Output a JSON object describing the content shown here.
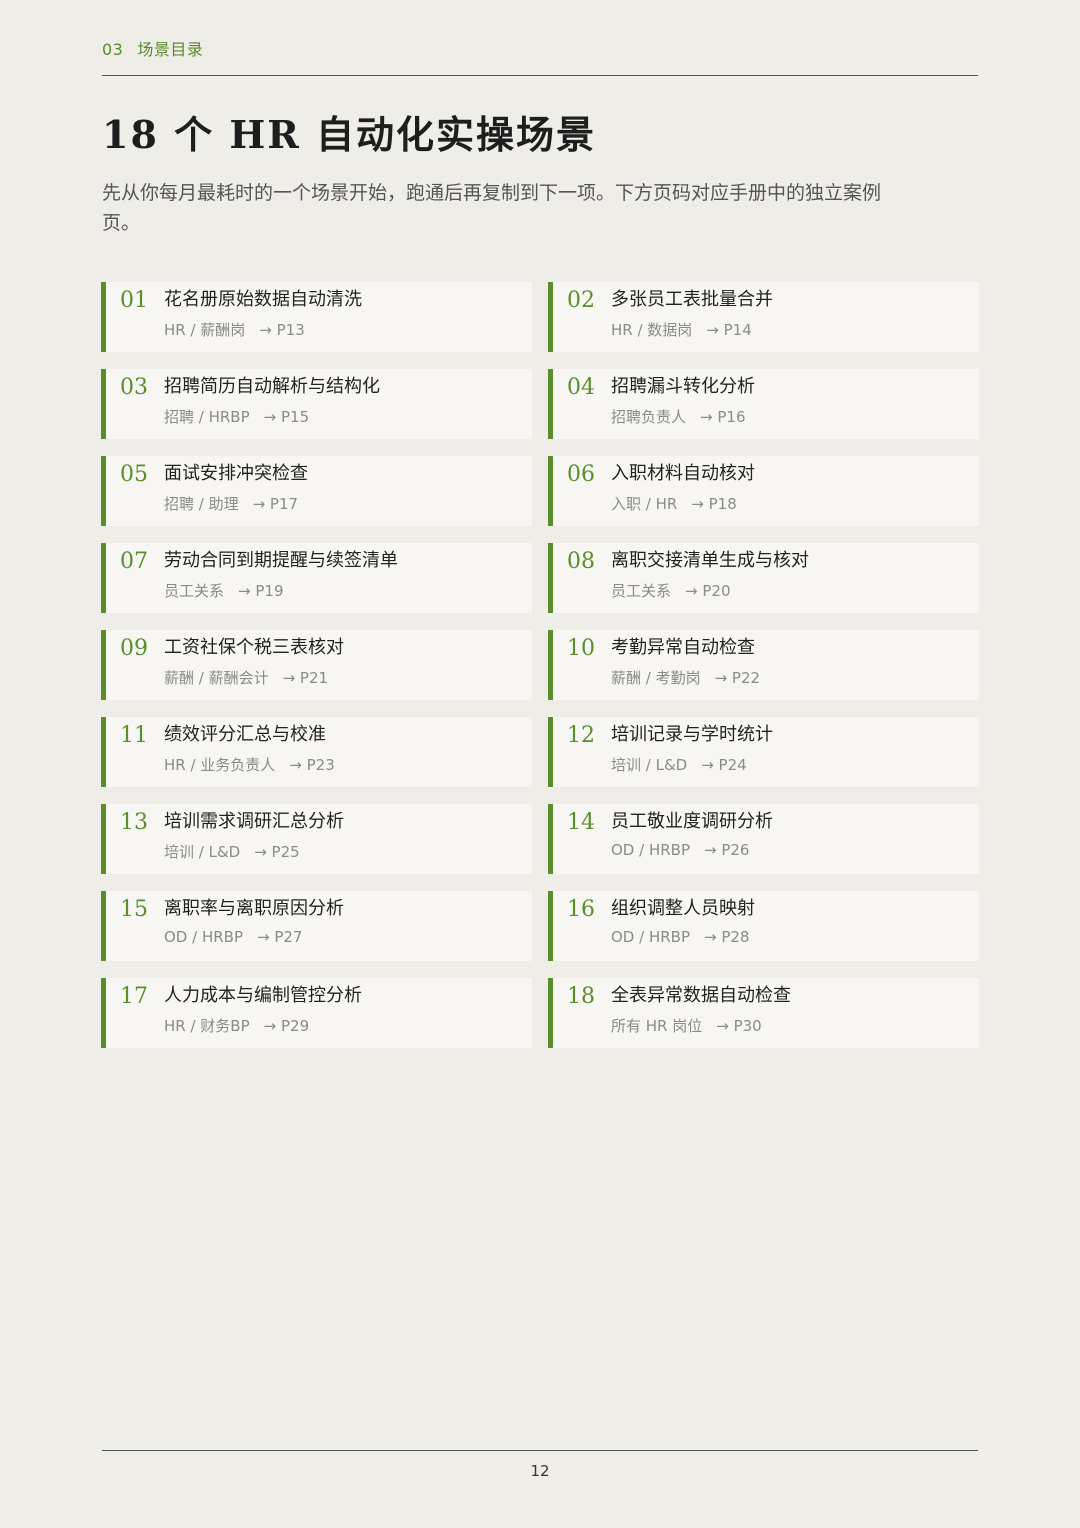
{
  "header": {
    "section_num": "03",
    "section_title": "场景目录"
  },
  "title": "18 个 HR 自动化实操场景",
  "intro": "先从你每月最耗时的一个场景开始，跑通后再复制到下一项。下方页码对应手册中的独立案例页。",
  "scenarios": [
    {
      "num": "01",
      "title": "花名册原始数据自动清洗",
      "roles": "HR / 薪酬岗",
      "page": "→ P13"
    },
    {
      "num": "02",
      "title": "多张员工表批量合并",
      "roles": "HR / 数据岗",
      "page": "→ P14"
    },
    {
      "num": "03",
      "title": "招聘简历自动解析与结构化",
      "roles": "招聘 / HRBP",
      "page": "→ P15"
    },
    {
      "num": "04",
      "title": "招聘漏斗转化分析",
      "roles": "招聘负责人",
      "page": "→ P16"
    },
    {
      "num": "05",
      "title": "面试安排冲突检查",
      "roles": "招聘 / 助理",
      "page": "→ P17"
    },
    {
      "num": "06",
      "title": "入职材料自动核对",
      "roles": "入职 / HR",
      "page": "→ P18"
    },
    {
      "num": "07",
      "title": "劳动合同到期提醒与续签清单",
      "roles": "员工关系",
      "page": "→ P19"
    },
    {
      "num": "08",
      "title": "离职交接清单生成与核对",
      "roles": "员工关系",
      "page": "→ P20"
    },
    {
      "num": "09",
      "title": "工资社保个税三表核对",
      "roles": "薪酬 / 薪酬会计",
      "page": "→ P21"
    },
    {
      "num": "10",
      "title": "考勤异常自动检查",
      "roles": "薪酬 / 考勤岗",
      "page": "→ P22"
    },
    {
      "num": "11",
      "title": "绩效评分汇总与校准",
      "roles": "HR / 业务负责人",
      "page": "→ P23"
    },
    {
      "num": "12",
      "title": "培训记录与学时统计",
      "roles": "培训 / L&D",
      "page": "→ P24"
    },
    {
      "num": "13",
      "title": "培训需求调研汇总分析",
      "roles": "培训 / L&D",
      "page": "→ P25"
    },
    {
      "num": "14",
      "title": "员工敬业度调研分析",
      "roles": "OD / HRBP",
      "page": "→ P26"
    },
    {
      "num": "15",
      "title": "离职率与离职原因分析",
      "roles": "OD / HRBP",
      "page": "→ P27"
    },
    {
      "num": "16",
      "title": "组织调整人员映射",
      "roles": "OD / HRBP",
      "page": "→ P28"
    },
    {
      "num": "17",
      "title": "人力成本与编制管控分析",
      "roles": "HR / 财务BP",
      "page": "→ P29"
    },
    {
      "num": "18",
      "title": "全表异常数据自动检查",
      "roles": "所有 HR 岗位",
      "page": "→ P30"
    }
  ],
  "footer": {
    "page_number": "12"
  },
  "colors": {
    "accent": "#5a8d2c",
    "background": "#efede8",
    "card": "#f7f6f3"
  }
}
